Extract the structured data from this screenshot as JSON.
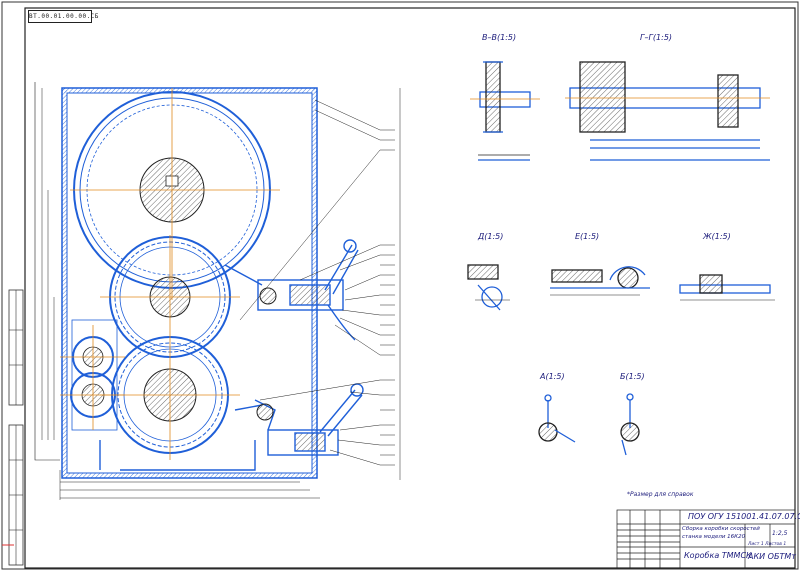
{
  "stamp_top_left": "ВТ.00.01.00.00.СБ",
  "section_labels": {
    "vv": "В–В(1:5)",
    "gg": "Г–Г(1:5)",
    "d": "Д(1:5)",
    "e": "Е(1:5)",
    "zh": "Ж(1:5)",
    "a": "А(1:5)",
    "b": "Б(1:5)"
  },
  "note": "*Размер для справок",
  "title_block": {
    "designation": "ПОУ ОГУ 151001.41.07.07.СБ",
    "name_line1": "Сборка коробки скоростей",
    "name_line2": "станка модели 16К20",
    "scale": "1:2,5",
    "sheet_info": "Лист 1  Листов 1",
    "material": "Коробка ТММСК",
    "org": "АКИ ОБТМт"
  },
  "colors": {
    "line_blue": "#1f5fd8",
    "outline": "#1a1a1a",
    "accent_orange": "#e08a1e",
    "hatch": "#555555"
  }
}
